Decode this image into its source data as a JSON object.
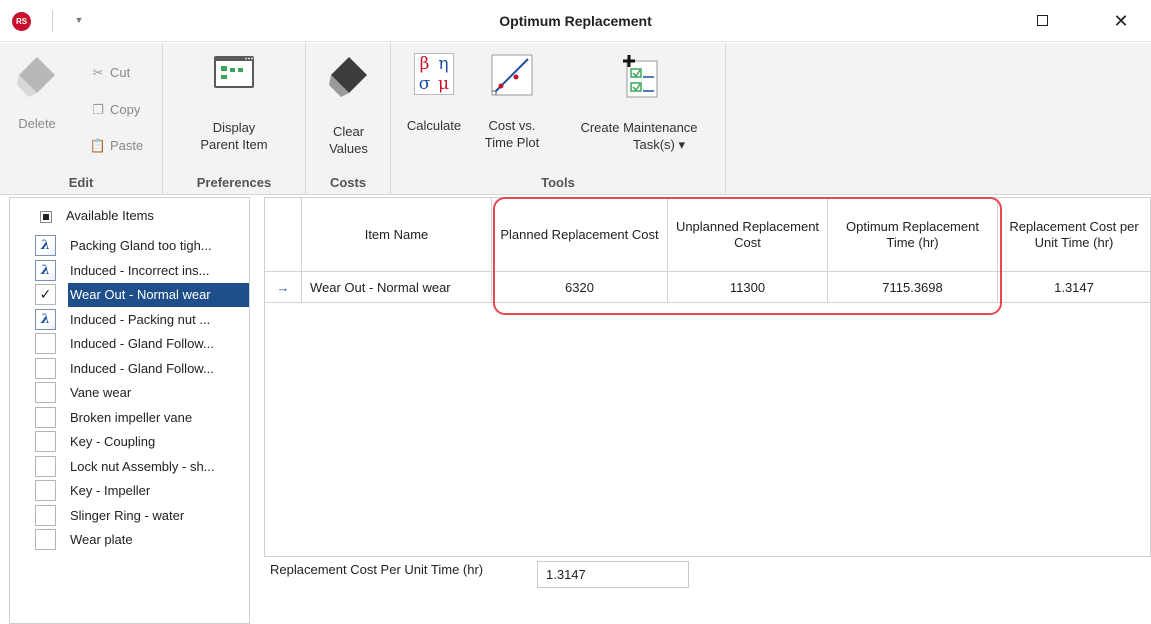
{
  "window": {
    "title": "Optimum Replacement",
    "app_logo_text": "RS",
    "maximize_icon": "maximize-icon",
    "close_glyph": "✕"
  },
  "ribbon": {
    "edit": {
      "label": "Edit",
      "delete": "Delete",
      "cut": "Cut",
      "copy": "Copy",
      "paste": "Paste"
    },
    "preferences": {
      "label": "Preferences",
      "display_parent_line1": "Display",
      "display_parent_line2": "Parent Item"
    },
    "costs": {
      "label": "Costs",
      "clear_line1": "Clear",
      "clear_line2": "Values"
    },
    "tools": {
      "label": "Tools",
      "calculate": "Calculate",
      "cost_plot_line1": "Cost vs.",
      "cost_plot_line2": "Time Plot",
      "create_task_line1": "Create Maintenance",
      "create_task_line2": "Task(s) ▾",
      "calc_symbols": [
        "β",
        "η",
        "σ",
        "μ"
      ]
    }
  },
  "left_pane": {
    "header_label": "Available Items",
    "items": [
      {
        "label": "Packing Gland too tigh...",
        "state": "lambda"
      },
      {
        "label": "Induced - Incorrect ins...",
        "state": "lambda"
      },
      {
        "label": "Wear Out - Normal wear",
        "state": "checked"
      },
      {
        "label": "Induced - Packing nut ...",
        "state": "lambda"
      },
      {
        "label": "Induced - Gland Follow...",
        "state": "empty"
      },
      {
        "label": "Induced - Gland Follow...",
        "state": "empty"
      },
      {
        "label": "Vane wear",
        "state": "empty"
      },
      {
        "label": "Broken impeller vane",
        "state": "empty"
      },
      {
        "label": "Key - Coupling",
        "state": "empty"
      },
      {
        "label": "Lock nut Assembly - sh...",
        "state": "empty"
      },
      {
        "label": "Key - Impeller",
        "state": "empty"
      },
      {
        "label": "Slinger Ring - water",
        "state": "empty"
      },
      {
        "label": "Wear plate",
        "state": "empty"
      }
    ]
  },
  "grid": {
    "columns": {
      "item_name": "Item Name",
      "planned": "Planned Replacement Cost",
      "unplanned": "Unplanned Replacement Cost",
      "optimum": "Optimum Replacement Time (hr)",
      "cost_per_unit": "Replacement Cost per Unit Time (hr)"
    },
    "rows": [
      {
        "indicator": "→",
        "item_name": "Wear Out - Normal wear",
        "planned": "6320",
        "unplanned": "11300",
        "optimum": "7115.3698",
        "cost_per_unit": "1.3147"
      }
    ]
  },
  "summary": {
    "label": "Replacement Cost Per Unit Time (hr)",
    "value": "1.3147"
  },
  "colors": {
    "highlight": "#e8474e",
    "selection": "#1e4f8a",
    "brand": "#c8102e"
  }
}
